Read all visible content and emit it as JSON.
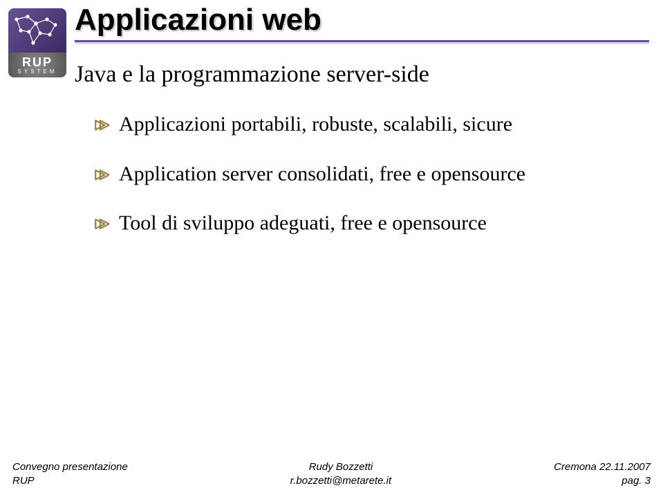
{
  "logo": {
    "brand": "RUP",
    "subbrand": "SYSTEM"
  },
  "title": "Applicazioni web",
  "subtitle": "Java e la programmazione server-side",
  "bullets": [
    "Applicazioni portabili, robuste, scalabili, sicure",
    "Application server consolidati, free e opensource",
    "Tool di sviluppo adeguati, free e opensource"
  ],
  "footer": {
    "left_line1": "Convegno presentazione",
    "left_line2": "RUP",
    "center_line1": "Rudy Bozzetti",
    "center_line2": "r.bozzetti@metarete.it",
    "right_line1": "Cremona 22.11.2007",
    "right_line2": "pag. 3"
  }
}
